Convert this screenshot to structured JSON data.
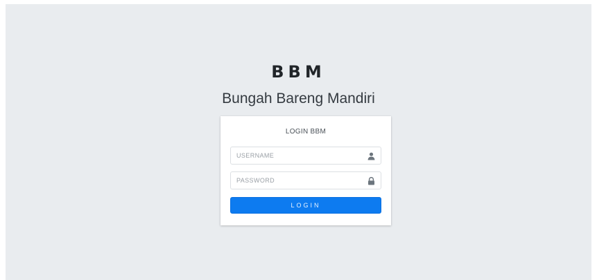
{
  "brand": {
    "logo_text": "BBM",
    "subtitle": "Bungah Bareng Mandiri"
  },
  "login_card": {
    "title": "LOGIN BBM",
    "username": {
      "placeholder": "USERNAME",
      "value": "",
      "icon": "user-icon"
    },
    "password": {
      "placeholder": "PASSWORD",
      "value": "",
      "icon": "lock-icon"
    },
    "submit_label": "LOGIN"
  },
  "colors": {
    "background": "#e9ecef",
    "card": "#ffffff",
    "primary_button": "#0d7bf0",
    "text_dark": "#212529"
  }
}
